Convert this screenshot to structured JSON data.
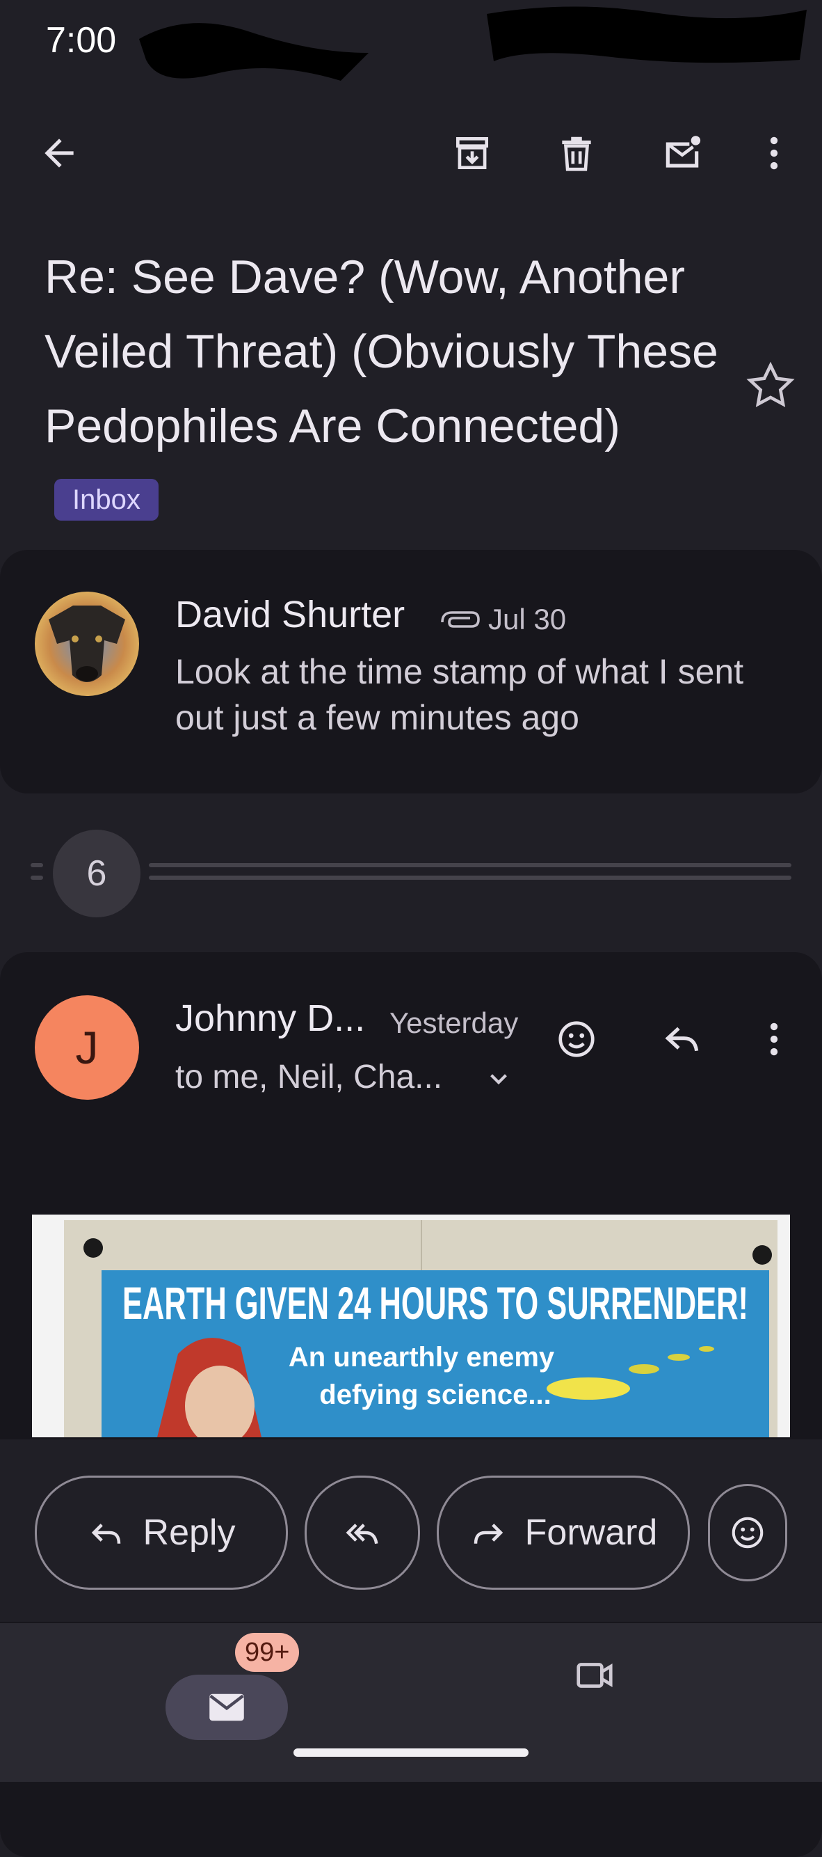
{
  "status_bar": {
    "time": "7:00"
  },
  "subject": {
    "text": "Re: See Dave? (Wow, Another Veiled Threat) (Obviously These Pedophiles Are Connected)",
    "label": "Inbox"
  },
  "message1": {
    "sender": "David Shurter",
    "date": "Jul 30",
    "snippet": "Look at the time stamp of what I sent out just a few minutes ago"
  },
  "collapsed": {
    "count": "6"
  },
  "message2": {
    "avatar_letter": "J",
    "sender": "Johnny D...",
    "date": "Yesterday",
    "recipients": "to me, Neil, Cha...",
    "poster": {
      "headline": "EARTH GIVEN 24 HOURS TO SURRENDER!",
      "line1": "An unearthly enemy",
      "line2": "defying science..."
    }
  },
  "actions": {
    "reply": "Reply",
    "forward": "Forward"
  },
  "nav": {
    "mail_badge": "99+"
  },
  "colors": {
    "accent_badge": "#4a3f8f",
    "avatar_orange": "#f5855f",
    "notif_badge": "#f6b3a4"
  }
}
